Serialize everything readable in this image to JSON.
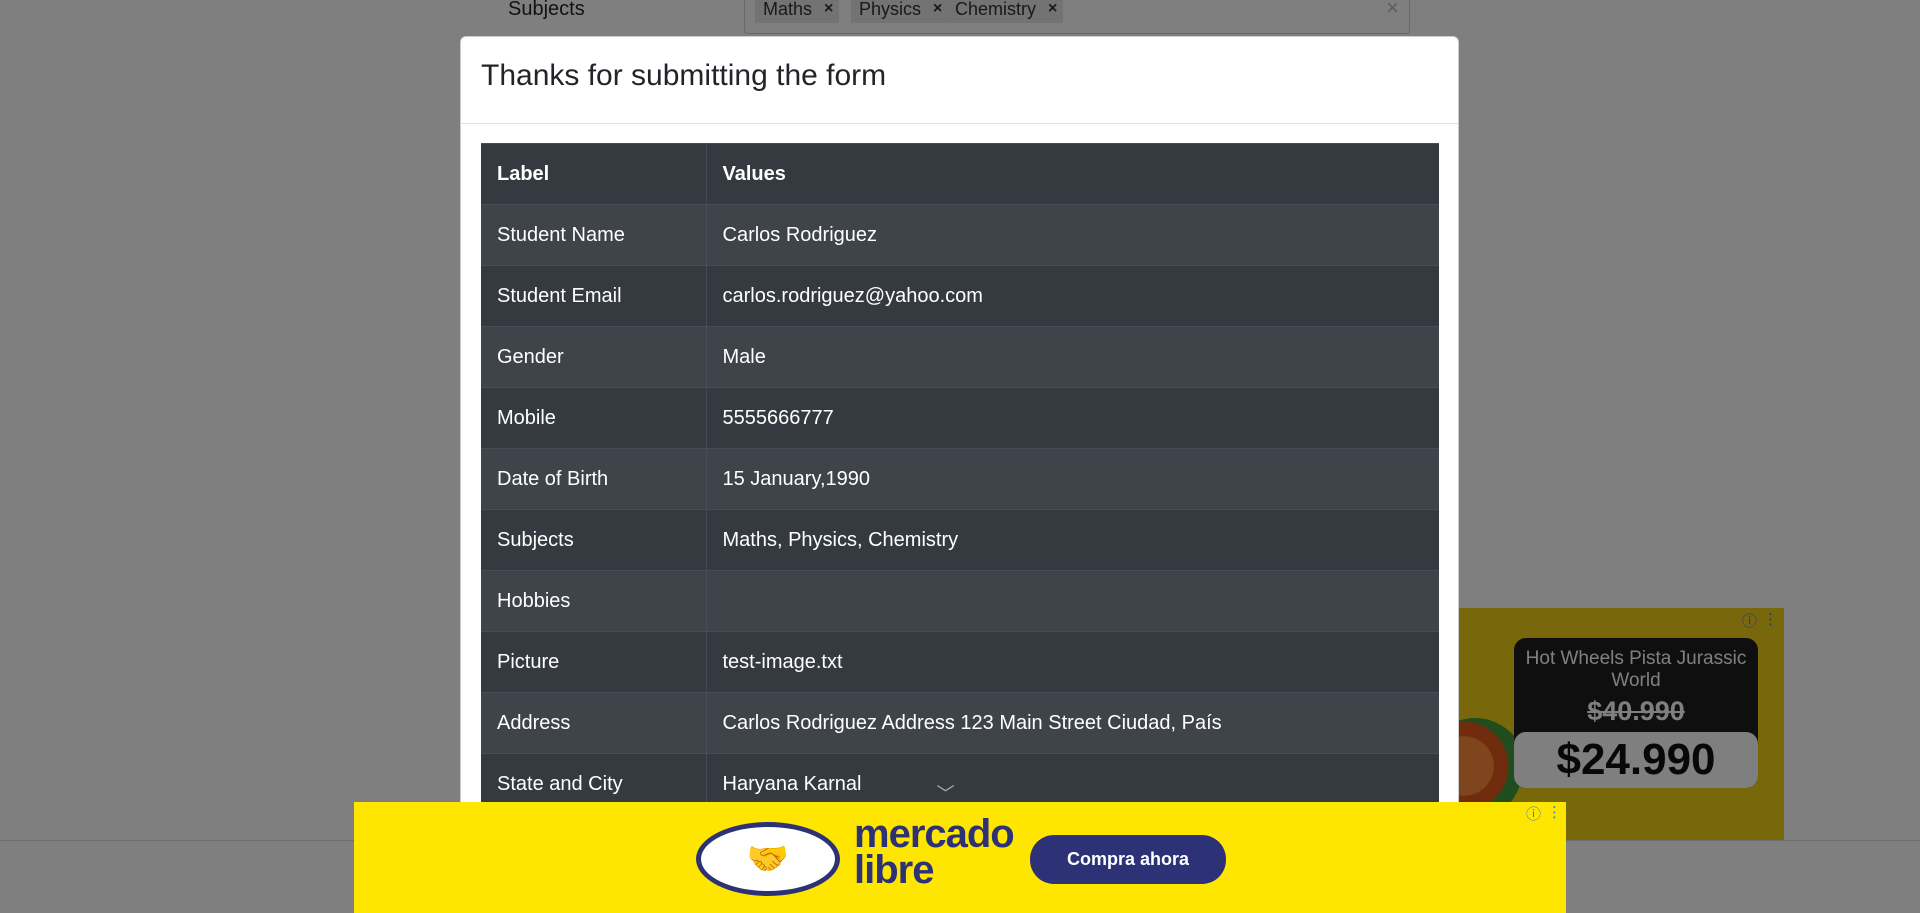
{
  "background": {
    "subjects_label": "Subjects",
    "subject_chips": [
      "Maths",
      "Physics",
      "Chemistry"
    ],
    "chip_remove_glyph": "×",
    "clear_glyph": "×"
  },
  "modal": {
    "title": "Thanks for submitting the form",
    "table": {
      "headers": [
        "Label",
        "Values"
      ],
      "rows": [
        {
          "label": "Student Name",
          "value": "Carlos Rodriguez"
        },
        {
          "label": "Student Email",
          "value": "carlos.rodriguez@yahoo.com"
        },
        {
          "label": "Gender",
          "value": "Male"
        },
        {
          "label": "Mobile",
          "value": "5555666777"
        },
        {
          "label": "Date of Birth",
          "value": "15 January,1990"
        },
        {
          "label": "Subjects",
          "value": "Maths, Physics, Chemistry"
        },
        {
          "label": "Hobbies",
          "value": ""
        },
        {
          "label": "Picture",
          "value": "test-image.txt"
        },
        {
          "label": "Address",
          "value": "Carlos Rodriguez Address 123 Main Street Ciudad, País"
        },
        {
          "label": "State and City",
          "value": "Haryana Karnal"
        }
      ]
    }
  },
  "ads": {
    "right": {
      "title": "Hot Wheels Pista Jurassic World",
      "old_price": "$40.990",
      "new_price": "$24.990"
    },
    "bottom": {
      "brand": "mercado libre",
      "cta": "Compra ahora",
      "colors": {
        "background": "#ffe600",
        "brand": "#2d3277"
      }
    },
    "icons": [
      "info-icon",
      "more-options-icon"
    ]
  }
}
